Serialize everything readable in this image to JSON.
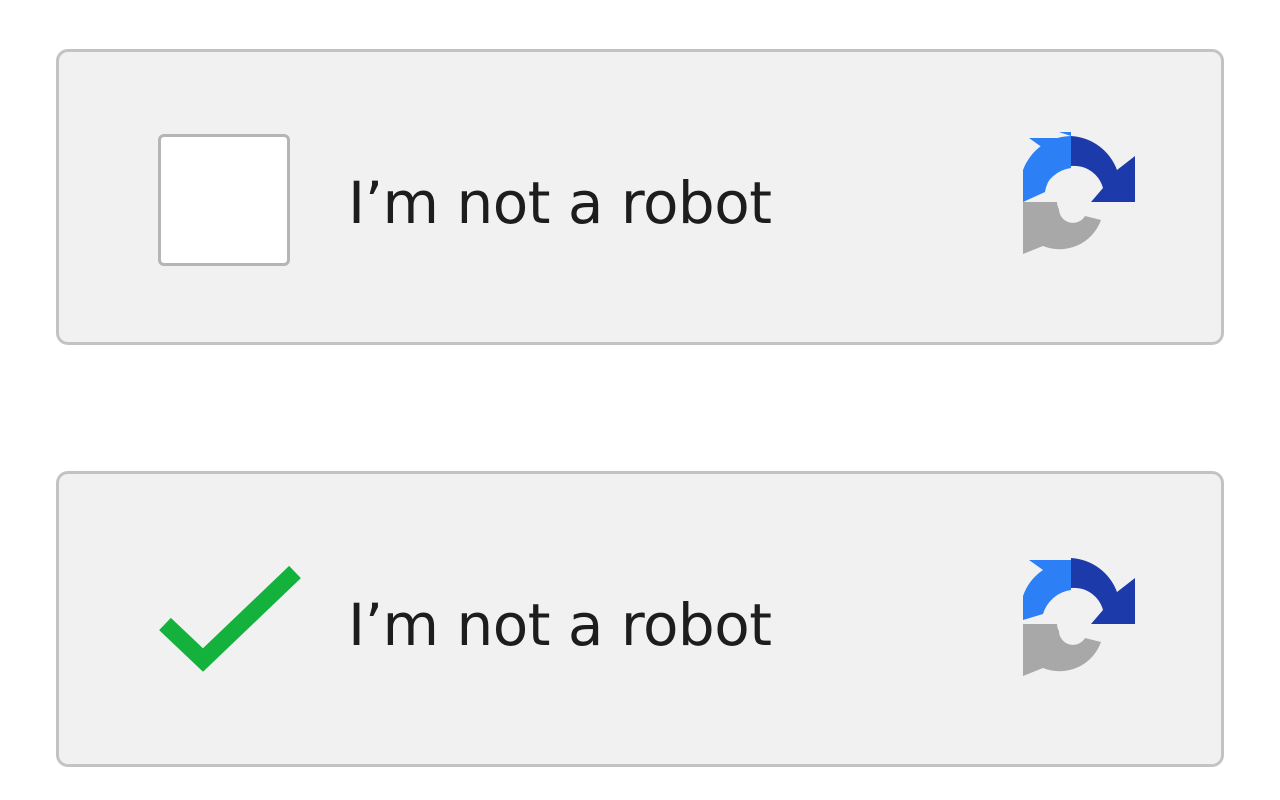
{
  "captcha_widgets": [
    {
      "state": "unchecked",
      "label": "I’m not a robot",
      "logo_icon": "recaptcha-icon"
    },
    {
      "state": "checked",
      "label": "I’m not a robot",
      "checkmark_icon": "checkmark-icon",
      "logo_icon": "recaptcha-icon"
    }
  ],
  "colors": {
    "widget_background": "#f1f1f1",
    "widget_border": "#c3c3c3",
    "checkbox_border": "#b5b5b5",
    "checkmark_green": "#14b13c",
    "logo_light_blue": "#2c7ff5",
    "logo_dark_blue": "#1c3aa9",
    "logo_gray": "#a8a8a8"
  }
}
